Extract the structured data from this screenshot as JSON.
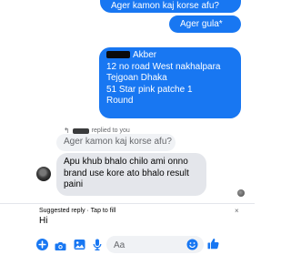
{
  "messages": {
    "sent_1": "Ager kamon kaj korse afu?",
    "sent_2": "Ager gula*",
    "address_card": {
      "name_visible": "Akber",
      "lines": [
        "12 no road West nakhalpara",
        "Tejgoan Dhaka",
        "51 Star pink patche 1",
        "Round"
      ],
      "tail_visible": "k"
    },
    "reply_header": "replied to you",
    "quoted_text": "Ager kamon kaj korse afu?",
    "incoming_text": "Apu khub bhalo chilo ami onno brand use kore ato bhalo result paini"
  },
  "suggested_reply": {
    "label": "Suggested reply · Tap to fill",
    "text": "Hi",
    "close": "×"
  },
  "composer": {
    "placeholder": "Aa",
    "icons": [
      "plus-icon",
      "camera-icon",
      "image-icon",
      "mic-icon",
      "emoji-icon",
      "like-icon"
    ]
  },
  "colors": {
    "accent": "#1877f2",
    "incoming_bubble": "#e4e6eb",
    "quoted_bubble": "#f0f2f5",
    "secondary_text": "#65676b"
  }
}
